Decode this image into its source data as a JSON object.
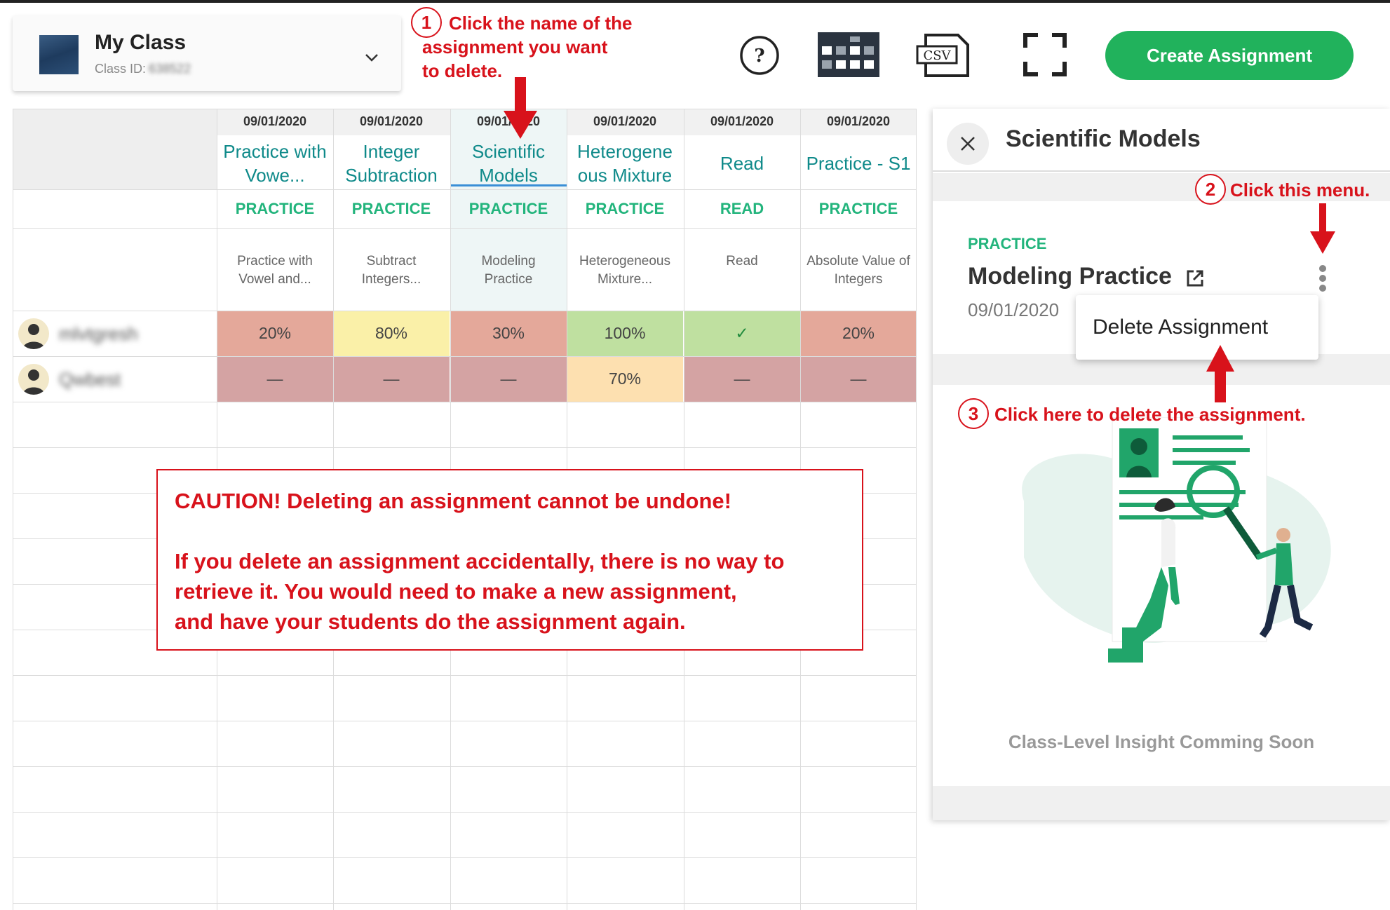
{
  "class_selector": {
    "name": "My Class",
    "id_label": "Class ID:",
    "id_value": "638522"
  },
  "toolbar": {
    "help_icon": "question-circle-icon",
    "grid_icon": "grid-view-icon",
    "csv_label": "CSV",
    "fullscreen_icon": "fullscreen-icon",
    "create_label": "Create Assignment",
    "create_color": "#21b25c"
  },
  "columns": [
    {
      "date": "09/01/2020",
      "title": "Practice with Vowe...",
      "type": "PRACTICE",
      "desc": "Practice with Vowel and..."
    },
    {
      "date": "09/01/2020",
      "title": "Integer Subtraction",
      "type": "PRACTICE",
      "desc": "Subtract Integers..."
    },
    {
      "date": "09/01/2020",
      "title": "Scientific Models",
      "type": "PRACTICE",
      "desc": "Modeling Practice"
    },
    {
      "date": "09/01/2020",
      "title": "Heterogene ous Mixture",
      "type": "PRACTICE",
      "desc": "Heterogeneous Mixture..."
    },
    {
      "date": "09/01/2020",
      "title": "Read",
      "type": "READ",
      "desc": "Read"
    },
    {
      "date": "09/01/2020",
      "title": "Practice - S1",
      "type": "PRACTICE",
      "desc": "Absolute Value of Integers"
    }
  ],
  "students": [
    {
      "name": "mlvtgresh",
      "scores": [
        "20%",
        "80%",
        "30%",
        "100%",
        "✓",
        "20%"
      ],
      "colors": [
        "#e4a89a",
        "#faf0a8",
        "#e4a89a",
        "#bfe0a0",
        "#bfe0a0",
        "#e4a89a"
      ]
    },
    {
      "name": "Qwbest",
      "scores": [
        "—",
        "—",
        "—",
        "70%",
        "—",
        "—"
      ],
      "colors": [
        "#d4a3a3",
        "#d4a3a3",
        "#d4a3a3",
        "#fde0b0",
        "#d4a3a3",
        "#d4a3a3"
      ]
    }
  ],
  "caution": {
    "line1": "CAUTION! Deleting an assignment cannot be undone!",
    "line2": "If you delete an assignment accidentally, there is no way to",
    "line3": "retrieve it. You would need to make a new assignment,",
    "line4": "and have your students do the assignment again."
  },
  "panel": {
    "title": "Scientific Models",
    "type": "PRACTICE",
    "name": "Modeling Practice",
    "date": "09/01/2020",
    "menu_item": "Delete Assignment",
    "insight": "Class-Level Insight Comming Soon"
  },
  "annotations": {
    "step1_num": "1",
    "step1_line1": "Click the name of the",
    "step1_line2": "assignment you want",
    "step1_line3": "to delete.",
    "step2_num": "2",
    "step2_text": "Click this menu.",
    "step3_num": "3",
    "step3_text": "Click here to delete the assignment."
  }
}
